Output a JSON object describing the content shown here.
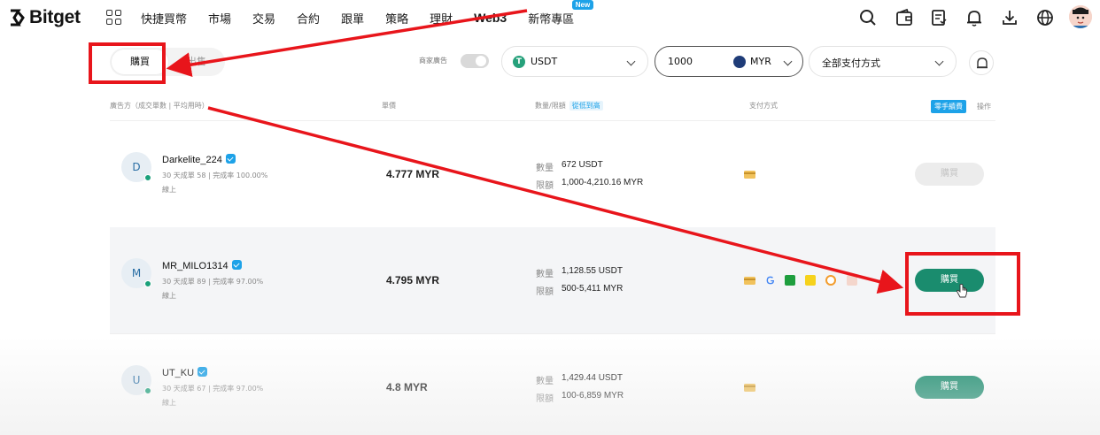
{
  "brand": {
    "name": "Bitget"
  },
  "nav": {
    "items": [
      {
        "label": "快捷買幣"
      },
      {
        "label": "市場"
      },
      {
        "label": "交易"
      },
      {
        "label": "合約"
      },
      {
        "label": "跟單"
      },
      {
        "label": "策略"
      },
      {
        "label": "理財"
      },
      {
        "label": "Web3"
      },
      {
        "label": "新幣專區",
        "badge": "New"
      }
    ],
    "icons": [
      "search-icon",
      "wallet-icon",
      "orders-icon",
      "bell-icon",
      "download-icon",
      "globe-icon",
      "avatar"
    ]
  },
  "filters": {
    "tab_buy": "購買",
    "tab_sell": "出售",
    "merchant_toggle_label": "商家廣告",
    "coin": "USDT",
    "amount": "1000",
    "currency": "MYR",
    "payment": "全部支付方式"
  },
  "table": {
    "col_advertiser": "廣告方（成交單數 | 平均用時）",
    "col_price": "單價",
    "col_quantity": "數量/限額",
    "sort_tag": "從低到高",
    "col_payment": "支付方式",
    "zero_fee": "零手續費",
    "col_action": "操作",
    "quantity_label": "數量",
    "limit_label": "限額",
    "rows": [
      {
        "initial": "D",
        "name": "Darkelite_224",
        "stats": "30 天成單 58 | 完成率 100.00%",
        "status": "線上",
        "price": "4.777 MYR",
        "quantity": "672 USDT",
        "limit": "1,000-4,210.16 MYR",
        "action": "購買"
      },
      {
        "initial": "M",
        "name": "MR_MILO1314",
        "stats": "30 天成單 89 | 完成率 97.00%",
        "status": "線上",
        "price": "4.795 MYR",
        "quantity": "1,128.55 USDT",
        "limit": "500-5,411 MYR",
        "action": "購買"
      },
      {
        "initial": "U",
        "name": "UT_KU",
        "stats": "30 天成單 67 | 完成率 97.00%",
        "status": "線上",
        "price": "4.8 MYR",
        "quantity": "1,429.44 USDT",
        "limit": "100-6,859 MYR",
        "action": "購買"
      }
    ]
  },
  "colors": {
    "accent_green": "#1a8c6e",
    "accent_blue": "#1da2e8",
    "annotation_red": "#e8151b"
  }
}
